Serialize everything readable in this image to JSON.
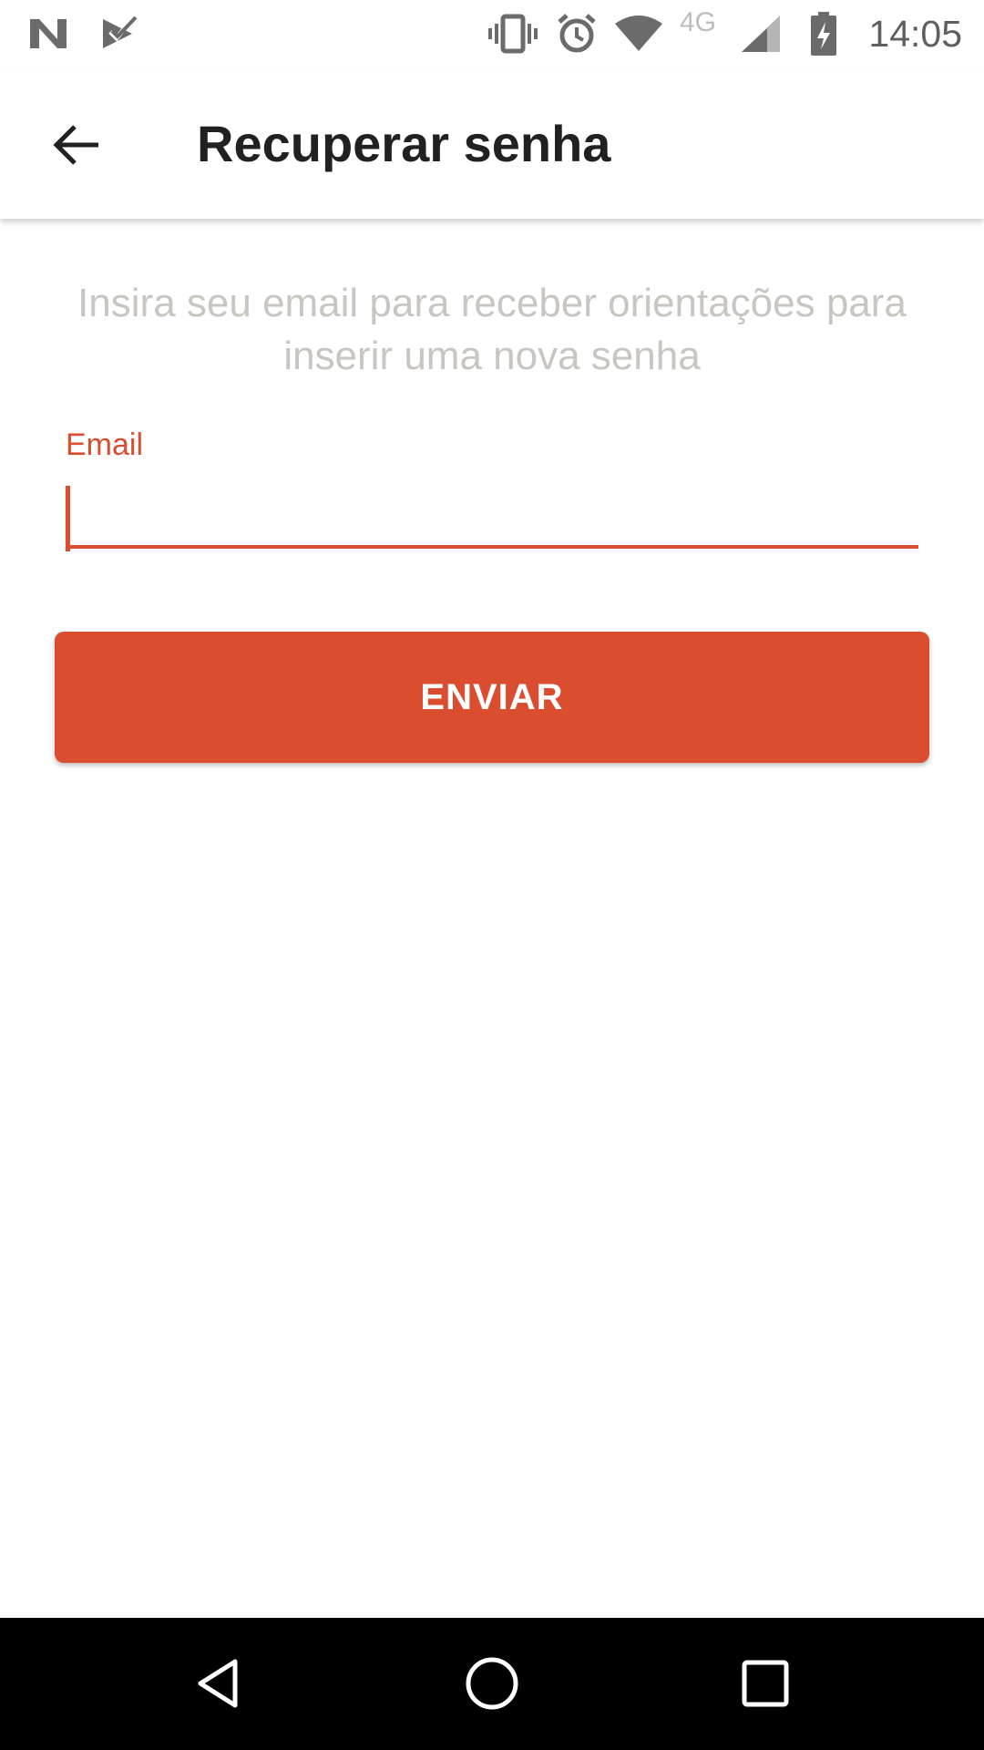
{
  "status_bar": {
    "time": "14:05",
    "network_type": "4G",
    "icons": [
      "n-notification-icon",
      "checkmark-notification-icon",
      "vibrate-icon",
      "alarm-icon",
      "wifi-icon",
      "cell-signal-icon",
      "battery-charging-icon"
    ]
  },
  "app_bar": {
    "title": "Recuperar senha",
    "back_icon": "arrow-back-icon"
  },
  "form": {
    "instructions": "Insira seu email para receber orientações para inserir uma nova senha",
    "email_label": "Email",
    "email_value": "",
    "submit_label": "ENVIAR"
  },
  "nav_bar": {
    "buttons": [
      "back-triangle-icon",
      "home-circle-icon",
      "recents-square-icon"
    ]
  },
  "colors": {
    "accent": "#db4d2f",
    "hint_text": "#c9c5c0",
    "title_text": "#212121"
  }
}
